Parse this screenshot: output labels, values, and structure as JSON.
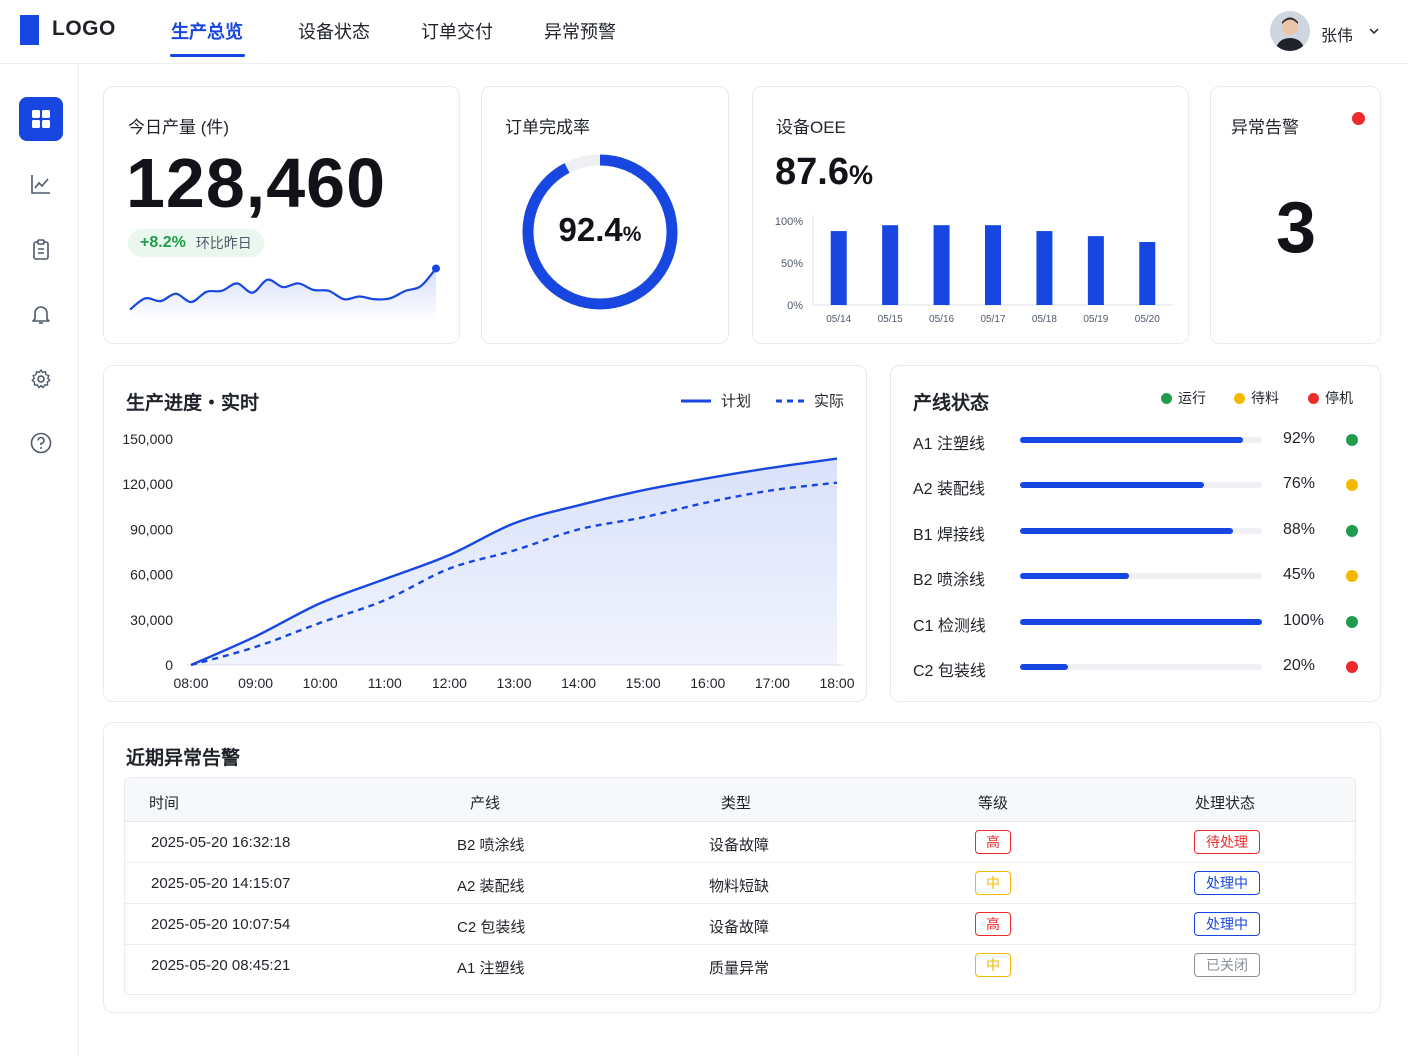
{
  "header": {
    "logo": "LOGO",
    "tabs": [
      {
        "label": "生产总览",
        "active": true
      },
      {
        "label": "设备状态",
        "active": false
      },
      {
        "label": "订单交付",
        "active": false
      },
      {
        "label": "异常预警",
        "active": false
      }
    ],
    "user_name": "张伟"
  },
  "sidebar": {
    "items": [
      {
        "icon": "dashboard-icon",
        "active": true
      },
      {
        "icon": "trend-chart-icon",
        "active": false
      },
      {
        "icon": "clipboard-icon",
        "active": false
      },
      {
        "icon": "bell-icon",
        "active": false
      },
      {
        "icon": "gear-icon",
        "active": false
      },
      {
        "icon": "help-icon",
        "active": false
      }
    ]
  },
  "kpi": {
    "output": {
      "title": "今日产量 (件)",
      "value": "128,460",
      "change": "+8.2%",
      "change_label": "环比昨日"
    },
    "order_rate": {
      "title": "订单完成率",
      "value": "92.4",
      "unit": "%",
      "fraction": 0.924
    },
    "oee": {
      "title": "设备OEE",
      "value": "87.6",
      "unit": "%"
    },
    "alerts": {
      "title": "异常告警",
      "value": "3"
    }
  },
  "colors": {
    "primary": "#1746e0",
    "running": "#1f9d4c",
    "waiting": "#f5b800",
    "stopped": "#f02a2a"
  },
  "progress": {
    "title": "生产进度・实时",
    "legend_plan": "计划",
    "legend_actual": "实际"
  },
  "lines": {
    "title": "产线状态",
    "legend": [
      {
        "label": "运行",
        "color": "#1f9d4c"
      },
      {
        "label": "待料",
        "color": "#f5b800"
      },
      {
        "label": "停机",
        "color": "#f02a2a"
      }
    ],
    "items": [
      {
        "name": "A1 注塑线",
        "pct": "92%",
        "value": 0.92,
        "color": "#1f9d4c"
      },
      {
        "name": "A2 装配线",
        "pct": "76%",
        "value": 0.76,
        "color": "#f5b800"
      },
      {
        "name": "B1 焊接线",
        "pct": "88%",
        "value": 0.88,
        "color": "#1f9d4c"
      },
      {
        "name": "B2 喷涂线",
        "pct": "45%",
        "value": 0.45,
        "color": "#f5b800"
      },
      {
        "name": "C1 检测线",
        "pct": "100%",
        "value": 1.0,
        "color": "#1f9d4c"
      },
      {
        "name": "C2 包装线",
        "pct": "20%",
        "value": 0.2,
        "color": "#f02a2a"
      }
    ]
  },
  "alerts_table": {
    "title": "近期异常告警",
    "headers": [
      "时间",
      "产线",
      "类型",
      "等级",
      "处理状态"
    ],
    "rows": [
      {
        "time": "2025-05-20 16:32:18",
        "line": "B2 喷涂线",
        "type": "设备故障",
        "level": "高",
        "level_color": "#f02a2a",
        "status": "待处理",
        "status_color": "#f02a2a"
      },
      {
        "time": "2025-05-20 14:15:07",
        "line": "A2 装配线",
        "type": "物料短缺",
        "level": "中",
        "level_color": "#f5b800",
        "status": "处理中",
        "status_color": "#1746e0"
      },
      {
        "time": "2025-05-20 10:07:54",
        "line": "C2 包装线",
        "type": "设备故障",
        "level": "高",
        "level_color": "#f02a2a",
        "status": "处理中",
        "status_color": "#1746e0"
      },
      {
        "time": "2025-05-20 08:45:21",
        "line": "A1 注塑线",
        "type": "质量异常",
        "level": "中",
        "level_color": "#f5b800",
        "status": "已关闭",
        "status_color": "#8a8f99"
      }
    ]
  },
  "chart_data": [
    {
      "type": "line",
      "title": "今日产量 (件)",
      "x": [
        0,
        1,
        2,
        3,
        4,
        5,
        6,
        7,
        8,
        9,
        10,
        11,
        12,
        13,
        14,
        15,
        16,
        17,
        18,
        19,
        20
      ],
      "series": [
        {
          "values": [
            8,
            20,
            17,
            25,
            16,
            27,
            28,
            36,
            26,
            40,
            32,
            36,
            29,
            28,
            19,
            22,
            19,
            20,
            28,
            33,
            52
          ]
        }
      ],
      "ylim": [
        0,
        60
      ]
    },
    {
      "type": "bar",
      "title": "设备OEE",
      "categories": [
        "05/14",
        "05/15",
        "05/16",
        "05/17",
        "05/18",
        "05/19",
        "05/20"
      ],
      "values": [
        88,
        95,
        95,
        95,
        88,
        82,
        75
      ],
      "yticks": [
        "100%",
        "50%",
        "0%"
      ],
      "ylim": [
        0,
        100
      ]
    },
    {
      "type": "area",
      "title": "生产进度・实时",
      "categories": [
        "08:00",
        "09:00",
        "10:00",
        "11:00",
        "12:00",
        "13:00",
        "14:00",
        "15:00",
        "16:00",
        "17:00",
        "18:00"
      ],
      "yticks": [
        "150,000",
        "120,000",
        "90,000",
        "60,000",
        "30,000",
        "0"
      ],
      "ylim": [
        0,
        150000
      ],
      "series": [
        {
          "name": "计划",
          "values": [
            0,
            19000,
            41000,
            57000,
            73000,
            94000,
            106000,
            116000,
            124000,
            131000,
            137000
          ]
        },
        {
          "name": "实际",
          "values": [
            0,
            12000,
            28000,
            43000,
            64000,
            76000,
            90000,
            98000,
            108000,
            116000,
            121000
          ]
        }
      ]
    }
  ]
}
